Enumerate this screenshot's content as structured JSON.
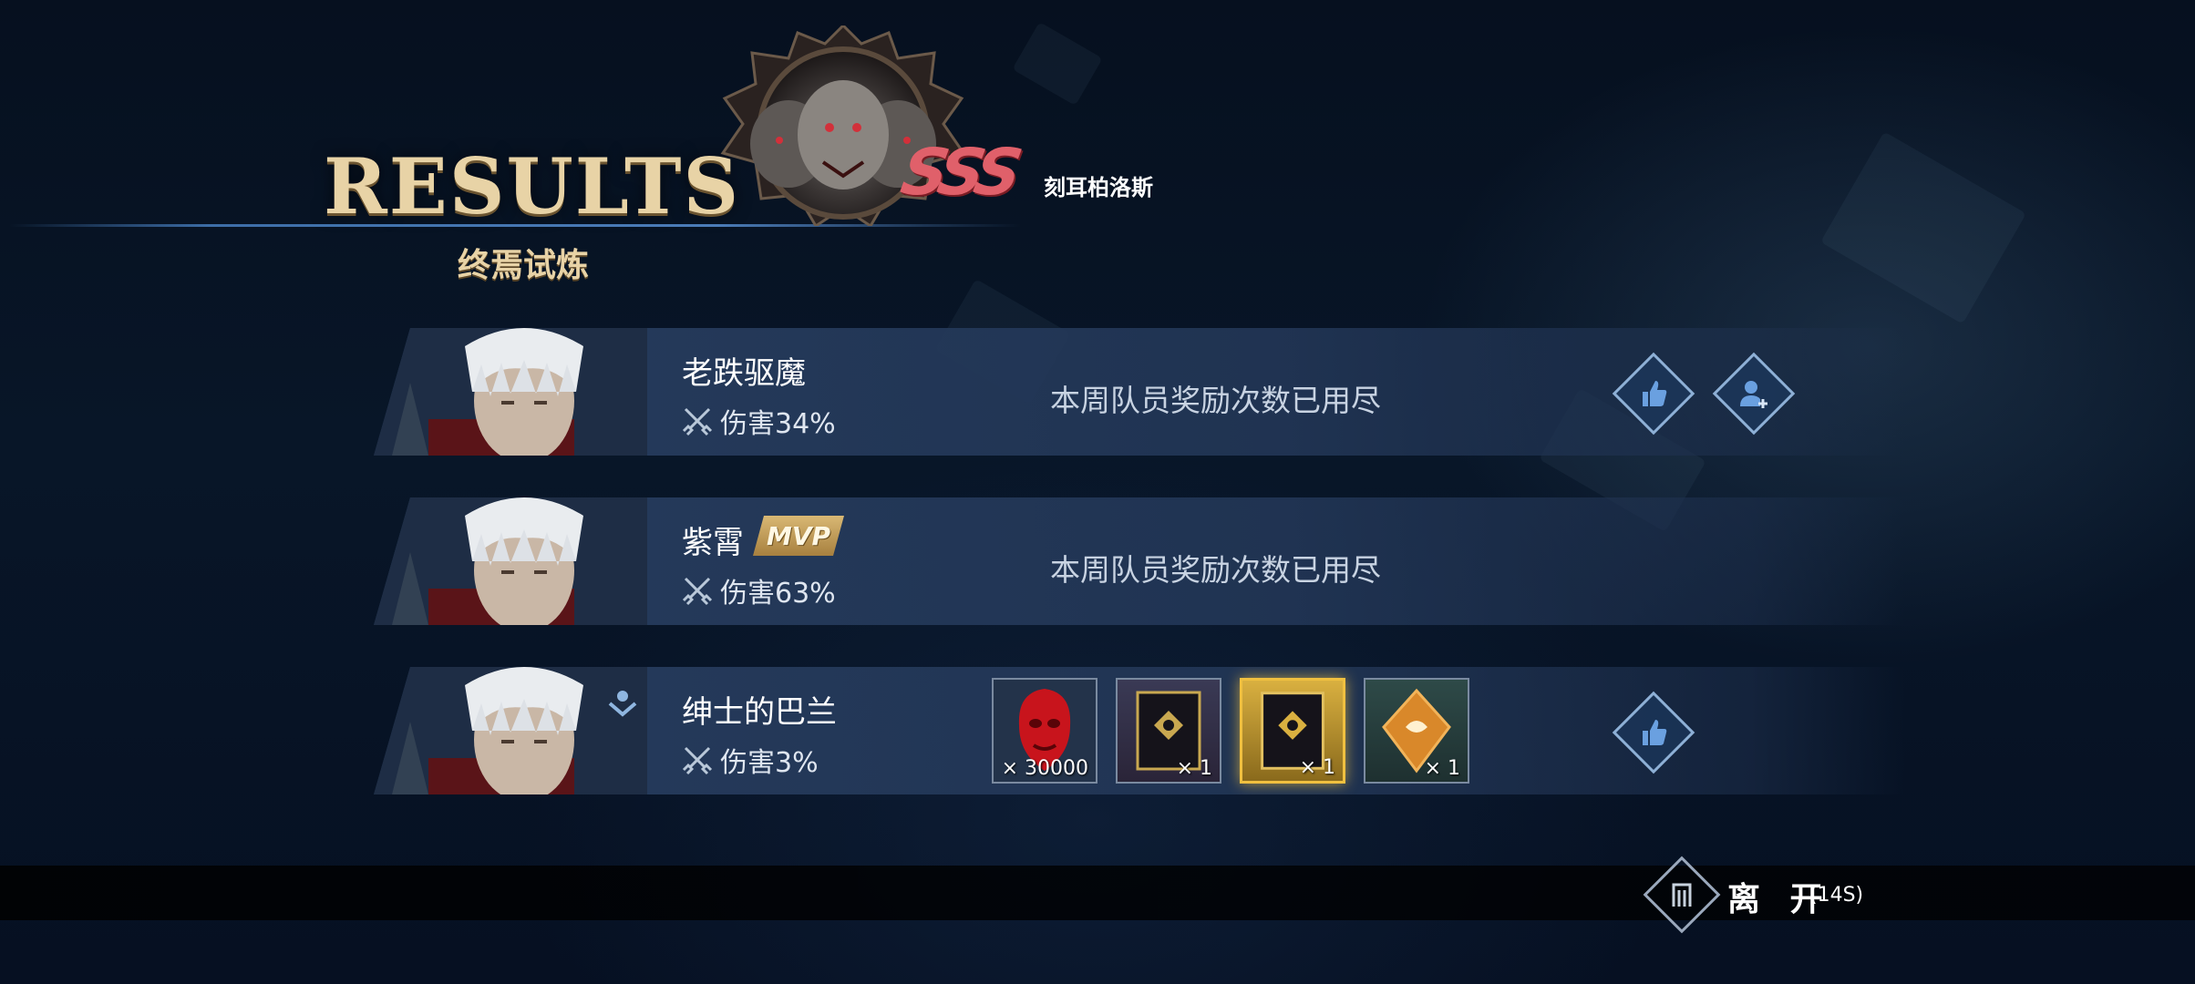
{
  "header": {
    "title": "RESULTS",
    "mode_name": "终焉试炼",
    "grade": "SSS",
    "boss_name": "刻耳柏洛斯"
  },
  "players": [
    {
      "name": "老跌驱魔",
      "damage_label": "伤害34%",
      "reward_message": "本周队员奖励次数已用尽",
      "mvp": false,
      "actions": [
        "like-icon",
        "add-friend-icon"
      ]
    },
    {
      "name": "紫霄",
      "mvp_label": "MVP",
      "damage_label": "伤害63%",
      "reward_message": "本周队员奖励次数已用尽",
      "mvp": true,
      "actions": []
    },
    {
      "name": "绅士的巴兰",
      "damage_label": "伤害3%",
      "mvp": false,
      "actions": [
        "like-icon"
      ],
      "rewards": [
        {
          "icon": "red-mask-icon",
          "quantity": "× 30000"
        },
        {
          "icon": "ornate-card-icon",
          "quantity": "× 1"
        },
        {
          "icon": "ornate-card-gold-icon",
          "quantity": "× 1",
          "selected": true
        },
        {
          "icon": "amber-crystal-icon",
          "quantity": "× 1"
        }
      ]
    }
  ],
  "footer": {
    "leave_label": "离 开",
    "timer": "(14S)"
  },
  "colors": {
    "title_gold": "#e8d3a6",
    "grade_red": "#e0606a",
    "row_bg": "#283e60",
    "selected_gold": "#f0c040"
  }
}
